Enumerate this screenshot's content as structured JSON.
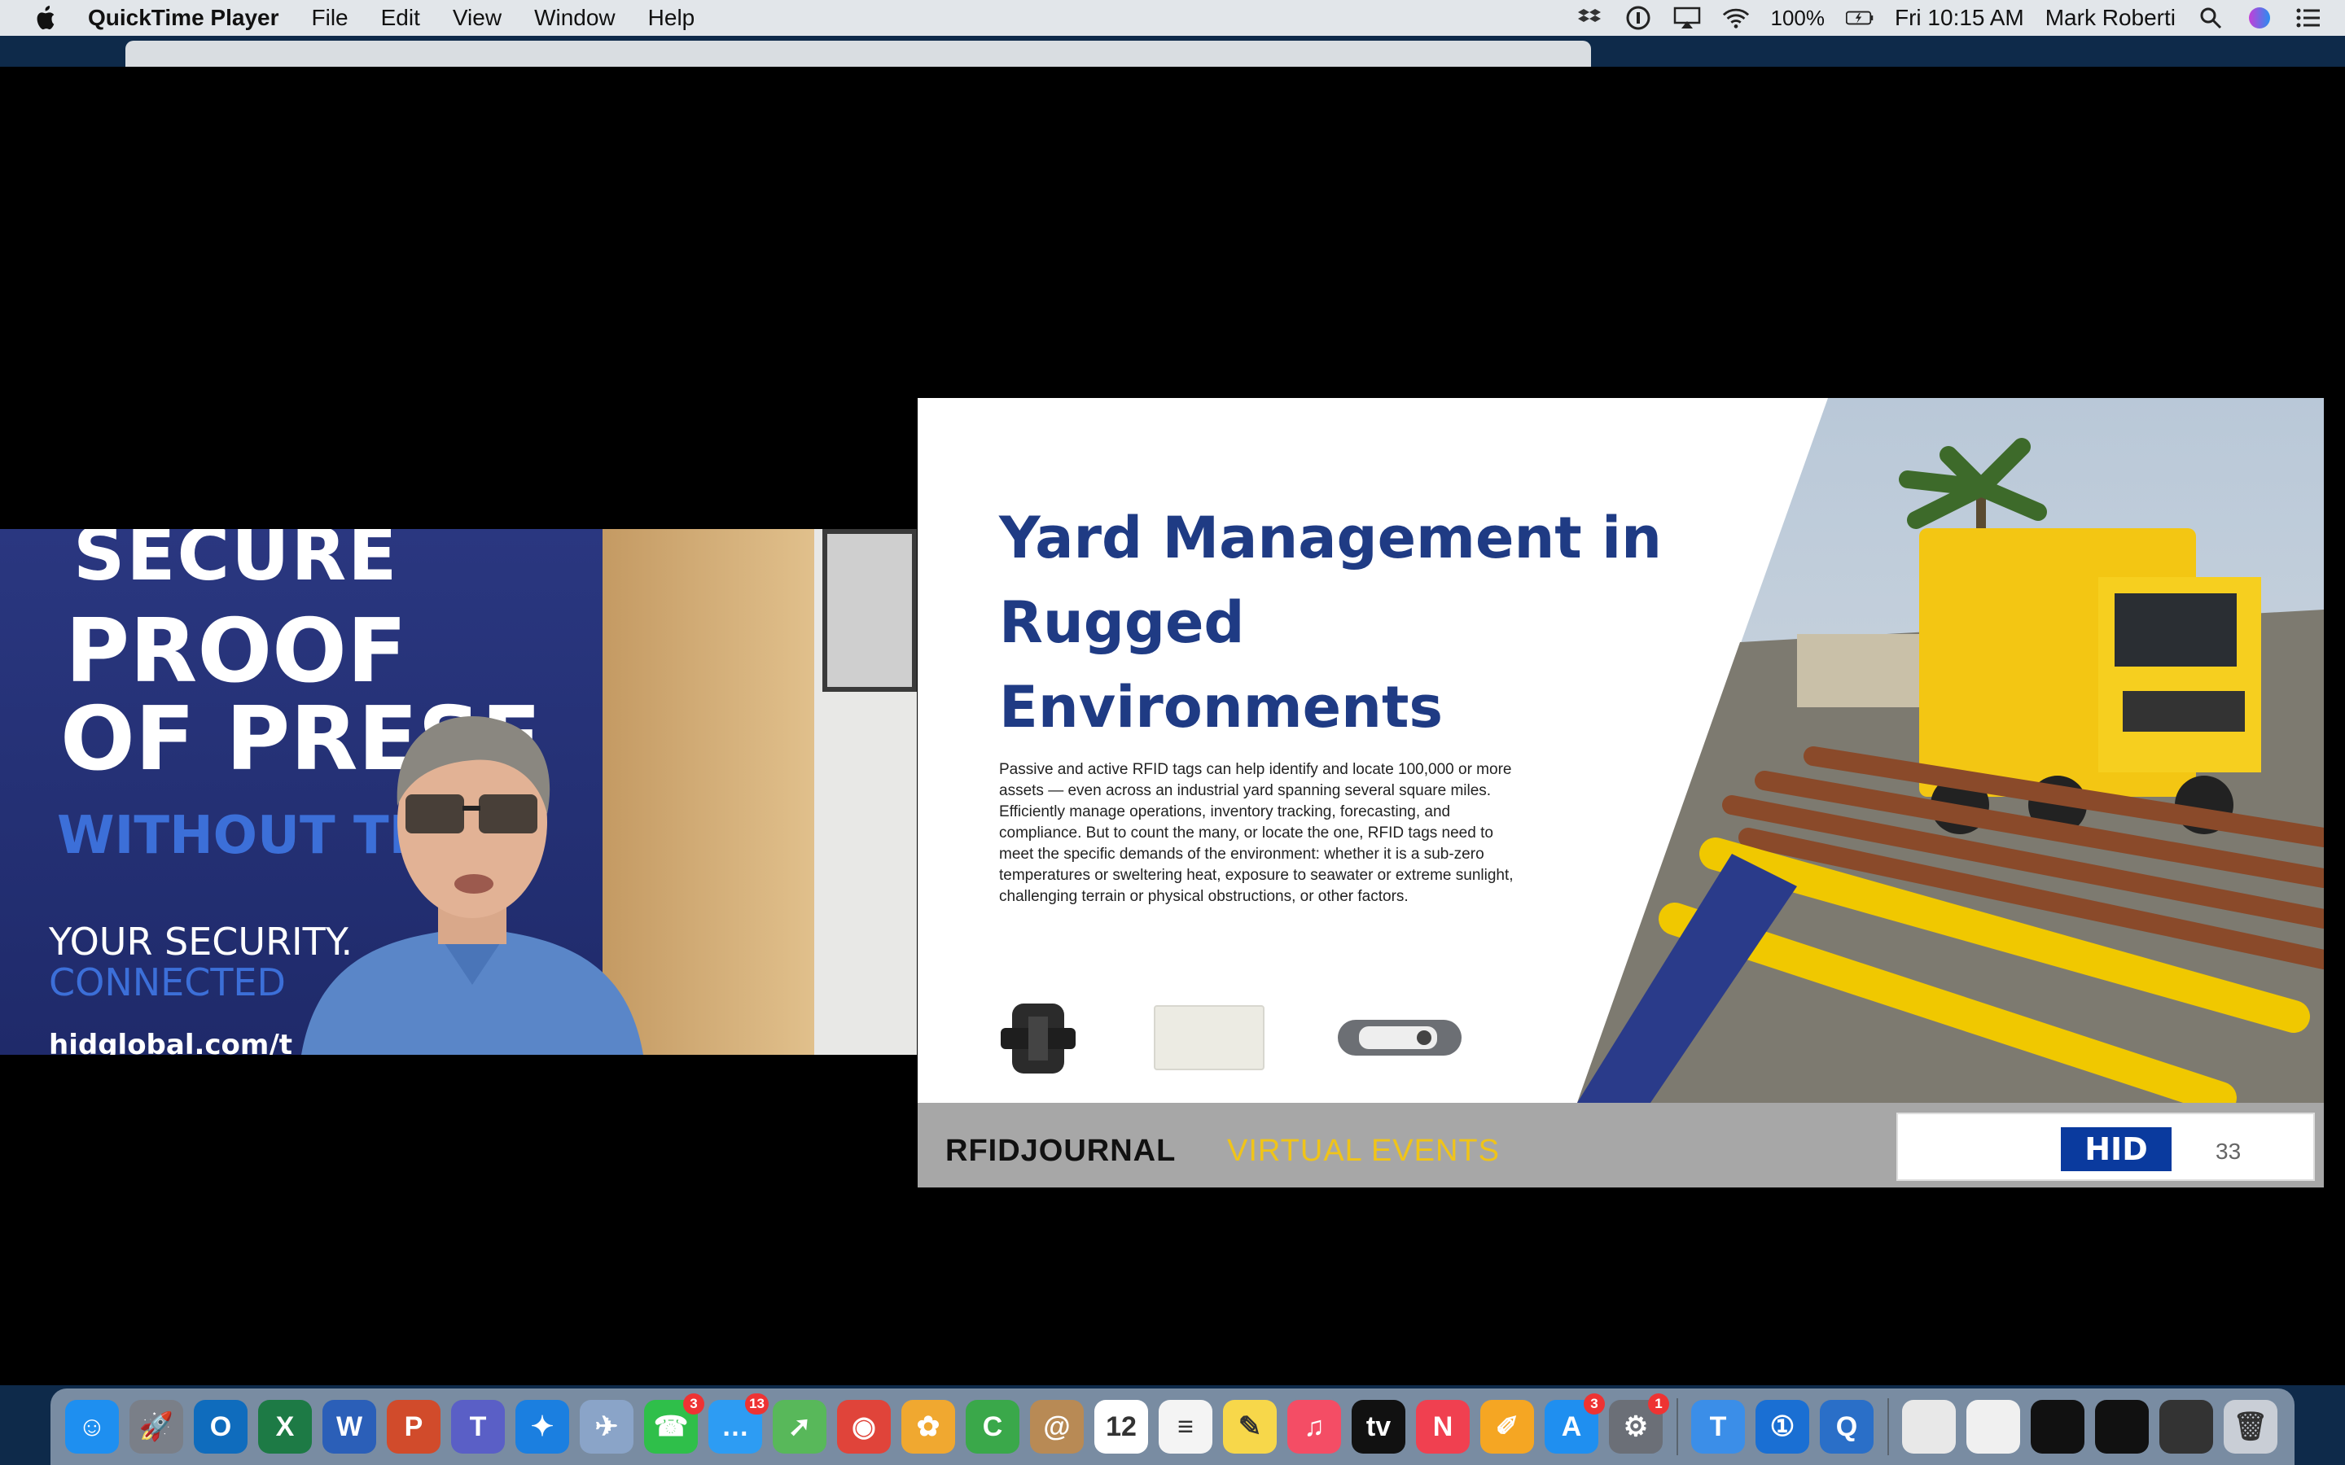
{
  "menubar": {
    "app_name": "QuickTime Player",
    "menus": [
      "File",
      "Edit",
      "View",
      "Window",
      "Help"
    ],
    "battery": "100%",
    "clock": "Fri 10:15 AM",
    "user": "Mark Roberti",
    "status_icons": [
      "dropbox-icon",
      "onepassword-icon",
      "airplay-icon",
      "wifi-icon",
      "battery-icon",
      "spotlight-icon",
      "siri-icon",
      "notification-center-icon"
    ]
  },
  "webcam": {
    "banner_secure": "SECURE",
    "banner_proof": "PROOF",
    "banner_ofpres": "OF PRESE",
    "banner_without": "WITHOUT THE H",
    "banner_your": "YOUR SECURITY.",
    "banner_connected": "CONNECTED",
    "banner_url": "hidglobal.com/t"
  },
  "slide": {
    "title_lines": [
      "Yard Management in",
      "Rugged",
      "Environments"
    ],
    "body": [
      "Passive and active RFID tags can help identify and locate 100,000  or more assets — even across an industrial yard spanning several square miles.",
      "Efficiently manage operations, inventory tracking, forecasting, and compliance. But to count the many, or locate the one, RFID tags need to meet the specific demands of the environment: whether it is a sub-zero temperatures or sweltering heat, exposure to seawater or extreme sunlight, challenging terrain or physical obstructions, or other factors."
    ],
    "footer_journal": "RFIDJOURNAL",
    "footer_events": "VIRTUAL EVENTS",
    "logo": "HID",
    "page_number": "33"
  },
  "dock": {
    "items": [
      {
        "name": "finder",
        "color": "#1e8ff0",
        "glyph": "☺"
      },
      {
        "name": "launchpad",
        "color": "#7a7f88",
        "glyph": "🚀"
      },
      {
        "name": "outlook",
        "color": "#0f6cbd",
        "glyph": "O"
      },
      {
        "name": "excel",
        "color": "#1d7a45",
        "glyph": "X"
      },
      {
        "name": "word",
        "color": "#2b5fb8",
        "glyph": "W"
      },
      {
        "name": "powerpoint",
        "color": "#d14b2b",
        "glyph": "P"
      },
      {
        "name": "teams",
        "color": "#5a5fc6",
        "glyph": "T"
      },
      {
        "name": "safari",
        "color": "#1b7fe0",
        "glyph": "✦"
      },
      {
        "name": "mail-bird",
        "color": "#8aa4c8",
        "glyph": "✈"
      },
      {
        "name": "facetime",
        "color": "#2fbf4a",
        "glyph": "☎",
        "badge": "3"
      },
      {
        "name": "messages",
        "color": "#2d9cf3",
        "glyph": "…",
        "badge": "13"
      },
      {
        "name": "maps",
        "color": "#58b85a",
        "glyph": "➚"
      },
      {
        "name": "chrome",
        "color": "#e0443a",
        "glyph": "◉"
      },
      {
        "name": "photos",
        "color": "#f0a830",
        "glyph": "✿"
      },
      {
        "name": "camtasia",
        "color": "#3aa84a",
        "glyph": "C"
      },
      {
        "name": "contacts",
        "color": "#b88a55",
        "glyph": "@"
      },
      {
        "name": "calendar",
        "color": "#ffffff",
        "glyph": "12"
      },
      {
        "name": "reminders",
        "color": "#f4f4f4",
        "glyph": "≡"
      },
      {
        "name": "notes",
        "color": "#f7d74a",
        "glyph": "✎"
      },
      {
        "name": "music",
        "color": "#f44d65",
        "glyph": "♫"
      },
      {
        "name": "appletv",
        "color": "#111111",
        "glyph": "tv"
      },
      {
        "name": "news",
        "color": "#f04050",
        "glyph": "N"
      },
      {
        "name": "pages",
        "color": "#f5a623",
        "glyph": "✐"
      },
      {
        "name": "appstore",
        "color": "#1f8ff0",
        "glyph": "A",
        "badge": "3"
      },
      {
        "name": "system-preferences",
        "color": "#6b6f77",
        "glyph": "⚙",
        "badge": "1"
      }
    ],
    "right_items": [
      {
        "name": "typora",
        "color": "#3b8ee8",
        "glyph": "T"
      },
      {
        "name": "onepassword",
        "color": "#1a6fd3",
        "glyph": "①"
      },
      {
        "name": "quicktime",
        "color": "#2a6fc8",
        "glyph": "Q"
      }
    ],
    "stack_items": [
      {
        "name": "document-stack",
        "color": "#e8e8e8",
        "glyph": ""
      },
      {
        "name": "window-thumb-1",
        "color": "#f0f0f0",
        "glyph": ""
      },
      {
        "name": "window-thumb-2",
        "color": "#111111",
        "glyph": ""
      },
      {
        "name": "window-thumb-3",
        "color": "#111111",
        "glyph": ""
      },
      {
        "name": "window-thumb-4",
        "color": "#333333",
        "glyph": ""
      },
      {
        "name": "trash",
        "color": "#c9ced6",
        "glyph": "🗑"
      }
    ]
  }
}
